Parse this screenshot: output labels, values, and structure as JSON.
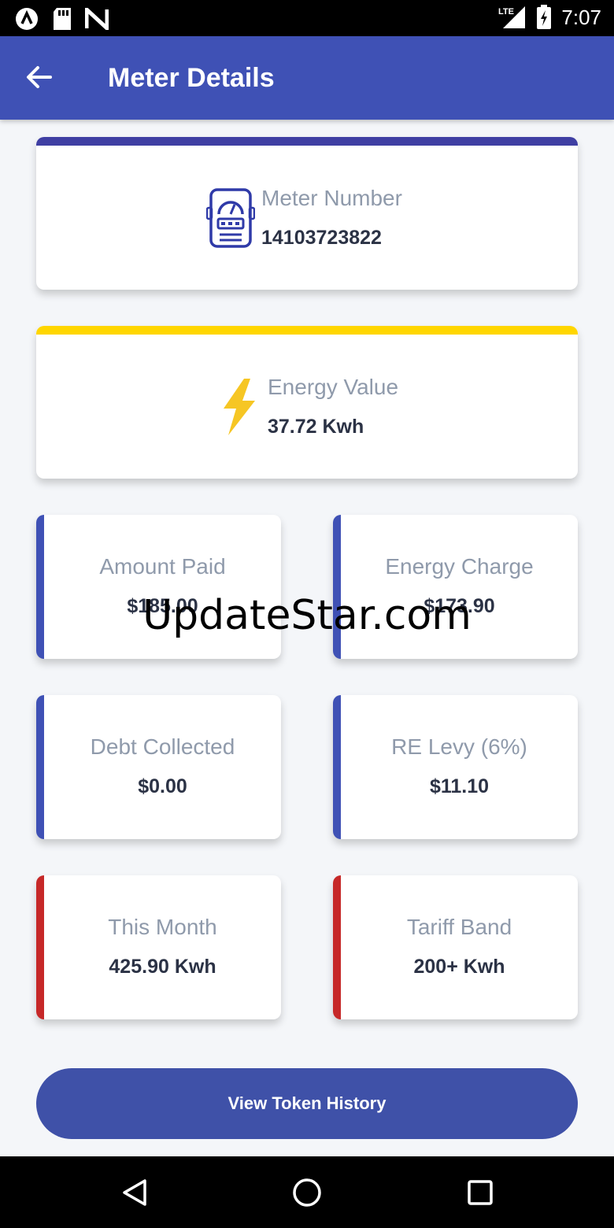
{
  "status_bar": {
    "time": "7:07",
    "left_icons": [
      "notification-a-icon",
      "sd-card-icon",
      "n-icon"
    ],
    "right_icons": [
      "lte-signal-icon",
      "battery-charging-icon"
    ],
    "lte_label": "LTE"
  },
  "app_bar": {
    "title": "Meter Details",
    "back_icon": "arrow-left-icon",
    "color": "#3f51b5"
  },
  "meter_card": {
    "label": "Meter Number",
    "value": "14103723822",
    "icon": "meter-icon",
    "accent": "#3f3fa3"
  },
  "energy_card": {
    "label": "Energy Value",
    "value": "37.72 Kwh",
    "icon": "lightning-bolt-icon",
    "accent": "#ffd600"
  },
  "stats": [
    {
      "label": "Amount Paid",
      "value": "$185.00",
      "accent": "#3f51b5"
    },
    {
      "label": "Energy Charge",
      "value": "$173.90",
      "accent": "#3f51b5"
    },
    {
      "label": "Debt Collected",
      "value": "$0.00",
      "accent": "#3f51b5"
    },
    {
      "label": "RE Levy (6%)",
      "value": "$11.10",
      "accent": "#3f51b5"
    },
    {
      "label": "This Month",
      "value": "425.90 Kwh",
      "accent": "#c62828"
    },
    {
      "label": "Tariff Band",
      "value": "200+ Kwh",
      "accent": "#c62828"
    }
  ],
  "history_button": {
    "label": "View Token History"
  },
  "watermark": "UpdateStar.com",
  "nav_bar": {
    "icons": [
      "back-triangle-icon",
      "home-circle-icon",
      "recents-square-icon"
    ]
  }
}
